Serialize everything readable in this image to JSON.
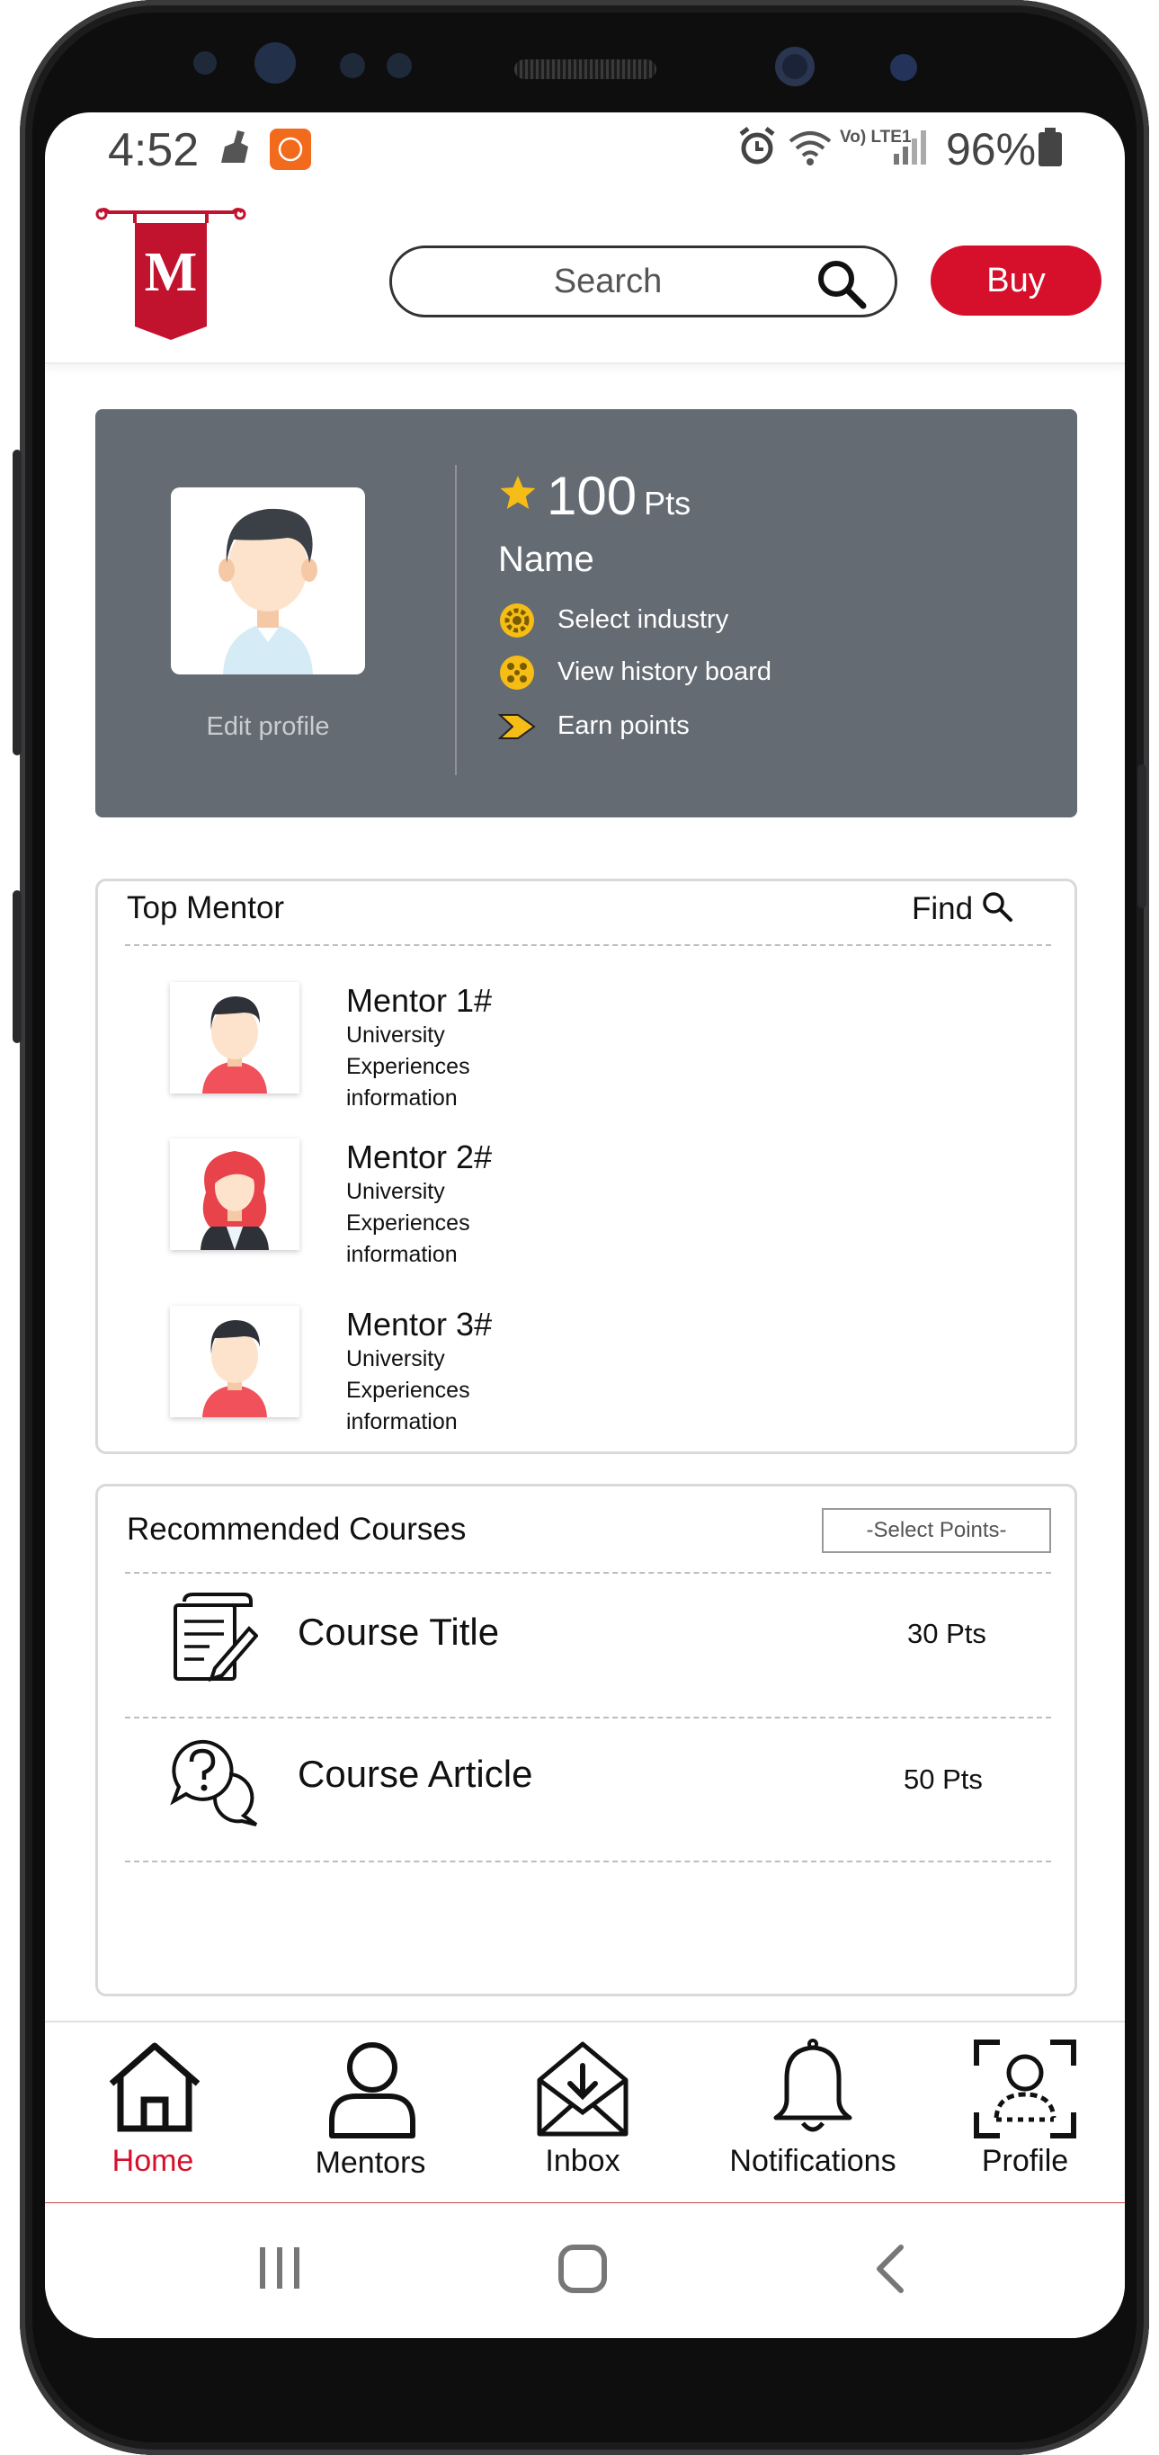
{
  "status_bar": {
    "time": "4:52",
    "battery": "96%",
    "network": "Vo) LTE1"
  },
  "header": {
    "logo_letter": "M",
    "search": {
      "placeholder": "Search"
    },
    "buy_label": "Buy",
    "brand_color": "#d6102b"
  },
  "profile": {
    "points_value": "100",
    "points_unit": "Pts",
    "name": "Name",
    "edit_label": "Edit profile",
    "menu": [
      {
        "label": "Select industry",
        "icon": "gear-icon"
      },
      {
        "label": "View history board",
        "icon": "history-board-icon"
      },
      {
        "label": "Earn points",
        "icon": "arrow-chevron-icon"
      }
    ],
    "card_color": "#646b72"
  },
  "top_mentor": {
    "title": "Top Mentor",
    "find_label": "Find",
    "mentors": [
      {
        "name": "Mentor 1#",
        "lines": [
          "University",
          "Experiences",
          "information"
        ]
      },
      {
        "name": "Mentor 2#",
        "lines": [
          "University",
          "Experiences",
          "information"
        ]
      },
      {
        "name": "Mentor 3#",
        "lines": [
          "University",
          "Experiences",
          "information"
        ]
      }
    ]
  },
  "courses": {
    "title": "Recommended Courses",
    "select_label": "-Select Points-",
    "items": [
      {
        "name": "Course Title",
        "points": "30 Pts",
        "icon": "document-pen-icon"
      },
      {
        "name": "Course Article",
        "points": "50 Pts",
        "icon": "question-chat-icon"
      }
    ]
  },
  "bottom_nav": {
    "items": [
      {
        "label": "Home",
        "icon": "home-icon",
        "active": true
      },
      {
        "label": "Mentors",
        "icon": "user-icon"
      },
      {
        "label": "Inbox",
        "icon": "inbox-icon"
      },
      {
        "label": "Notifications",
        "icon": "bell-icon"
      },
      {
        "label": "Profile",
        "icon": "profile-scan-icon"
      }
    ]
  }
}
